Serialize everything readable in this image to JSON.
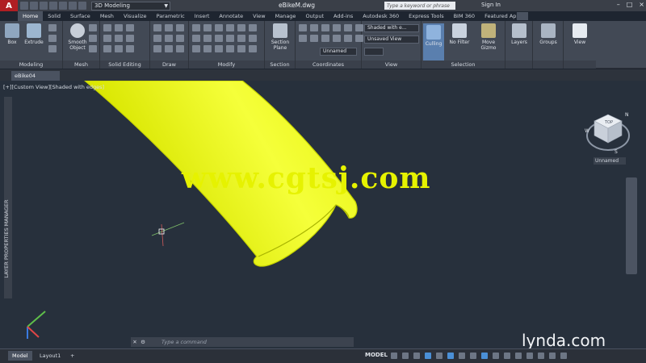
{
  "titlebar": {
    "logo": "A",
    "workspace": "3D Modeling",
    "document": "eBikeM.dwg",
    "search_placeholder": "Type a keyword or phrase",
    "signin": "Sign In",
    "window_buttons": [
      "–",
      "□",
      "×"
    ]
  },
  "tabs": [
    "Home",
    "Solid",
    "Surface",
    "Mesh",
    "Visualize",
    "Parametric",
    "Insert",
    "Annotate",
    "View",
    "Manage",
    "Output",
    "Add-ins",
    "Autodesk 360",
    "Express Tools",
    "BIM 360",
    "Featured Apps"
  ],
  "ribbon": {
    "modeling": {
      "title": "Modeling",
      "box": "Box",
      "extrude": "Extrude"
    },
    "mesh": {
      "title": "Mesh",
      "smooth": "Smooth Object"
    },
    "solid_editing": {
      "title": "Solid Editing"
    },
    "draw": {
      "title": "Draw"
    },
    "modify": {
      "title": "Modify"
    },
    "section": {
      "title": "Section",
      "section_plane": "Section Plane"
    },
    "coordinates": {
      "title": "Coordinates"
    },
    "view": {
      "title": "View",
      "visual_style": "Shaded with e...",
      "named_view": "Unsaved View",
      "unnamed": "Unnamed"
    },
    "selection": {
      "title": "Selection",
      "culling": "Culling",
      "no_filter": "No Filter",
      "move_gizmo": "Move Gizmo"
    },
    "layers": "Layers",
    "groups": "Groups",
    "view_btn": "View"
  },
  "file_tab": "eBike04",
  "viewport": {
    "label": "[+][Custom View][Shaded with edges]",
    "palette": "LAYER PROPERTIES MANAGER",
    "watermark": "www.cgtsj.com",
    "ucs_name": "Unnamed",
    "cube_labels": {
      "top": "TOP",
      "n": "N",
      "w": "W",
      "s": "S"
    }
  },
  "cmdline": {
    "placeholder": "Type a command"
  },
  "brand": "lynda.com",
  "status": {
    "layout_tabs": [
      "Model",
      "Layout1",
      "+"
    ],
    "model": "MODEL"
  },
  "colors": {
    "solid_fill": "#f2ff00",
    "solid_edge": "#c7d400",
    "accent": "#4a8fd6"
  }
}
